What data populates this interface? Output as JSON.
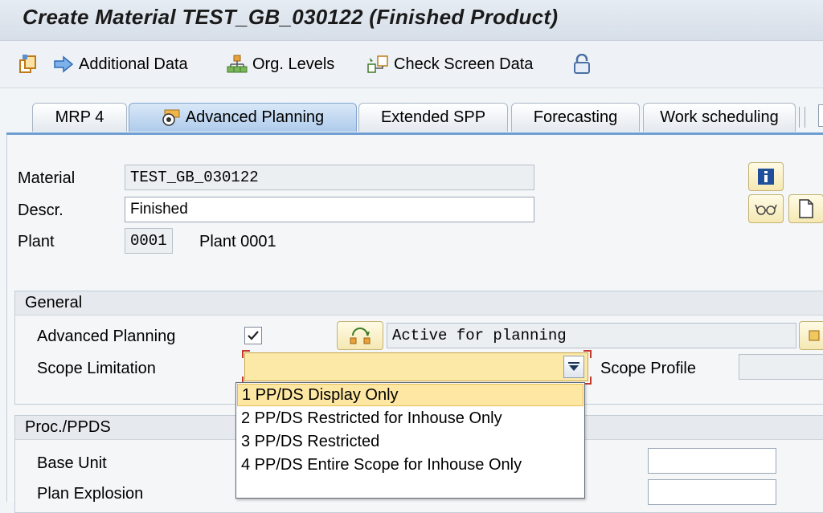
{
  "window": {
    "title": "Create Material TEST_GB_030122 (Finished Product)"
  },
  "toolbar": {
    "items": [
      {
        "label": "Additional Data",
        "icon": "arrow-right-icon"
      },
      {
        "label": "Org. Levels",
        "icon": "org-tree-icon"
      },
      {
        "label": "Check Screen Data",
        "icon": "check-screen-icon"
      }
    ]
  },
  "tabs": [
    {
      "label": "MRP 4"
    },
    {
      "label": "Advanced Planning",
      "active": true
    },
    {
      "label": "Extended SPP"
    },
    {
      "label": "Forecasting"
    },
    {
      "label": "Work scheduling"
    }
  ],
  "header": {
    "material_label": "Material",
    "material_value": "TEST_GB_030122",
    "descr_label": "Descr.",
    "descr_value": "Finished",
    "plant_label": "Plant",
    "plant_value": "0001",
    "plant_name": "Plant 0001"
  },
  "general": {
    "title": "General",
    "advanced_planning_label": "Advanced Planning",
    "advanced_planning_checked": true,
    "planning_status": "Active for planning",
    "scope_limitation_label": "Scope Limitation",
    "scope_limitation_value": "",
    "scope_profile_label": "Scope Profile",
    "scope_profile_value": ""
  },
  "scope_options": [
    "1 PP/DS Display Only",
    "2 PP/DS Restricted for Inhouse Only",
    "3 PP/DS Restricted",
    "4 PP/DS Entire Scope for Inhouse Only"
  ],
  "proc_ppds": {
    "title": "Proc./PPDS",
    "base_unit_label": "Base Unit",
    "plan_explosion_label": "Plan Explosion"
  },
  "colors": {
    "accent_tab": "#aecbeb",
    "dropdown_highlight": "#fde7a2",
    "button_yellow": "#f5e8b3"
  }
}
